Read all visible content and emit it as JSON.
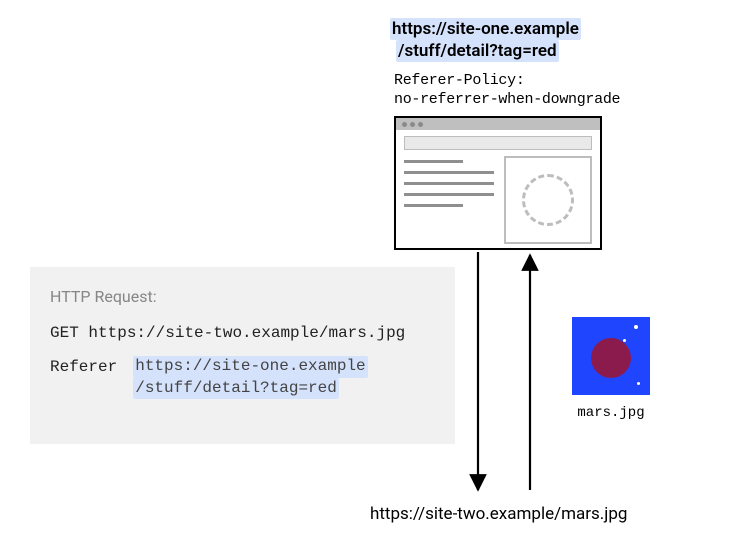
{
  "topUrl": {
    "line1": "https://site-one.example",
    "line2": "/stuff/detail?tag=red"
  },
  "policy": {
    "header": "Referer-Policy:",
    "value": "no-referrer-when-downgrade"
  },
  "request": {
    "title": "HTTP Request:",
    "method": "GET",
    "url": "https://site-two.example/mars.jpg",
    "refererKey": "Referer",
    "refererLine1": "https://site-one.example",
    "refererLine2": "/stuff/detail?tag=red"
  },
  "marsLabel": "mars.jpg",
  "resourceUrl": "https://site-two.example/mars.jpg"
}
